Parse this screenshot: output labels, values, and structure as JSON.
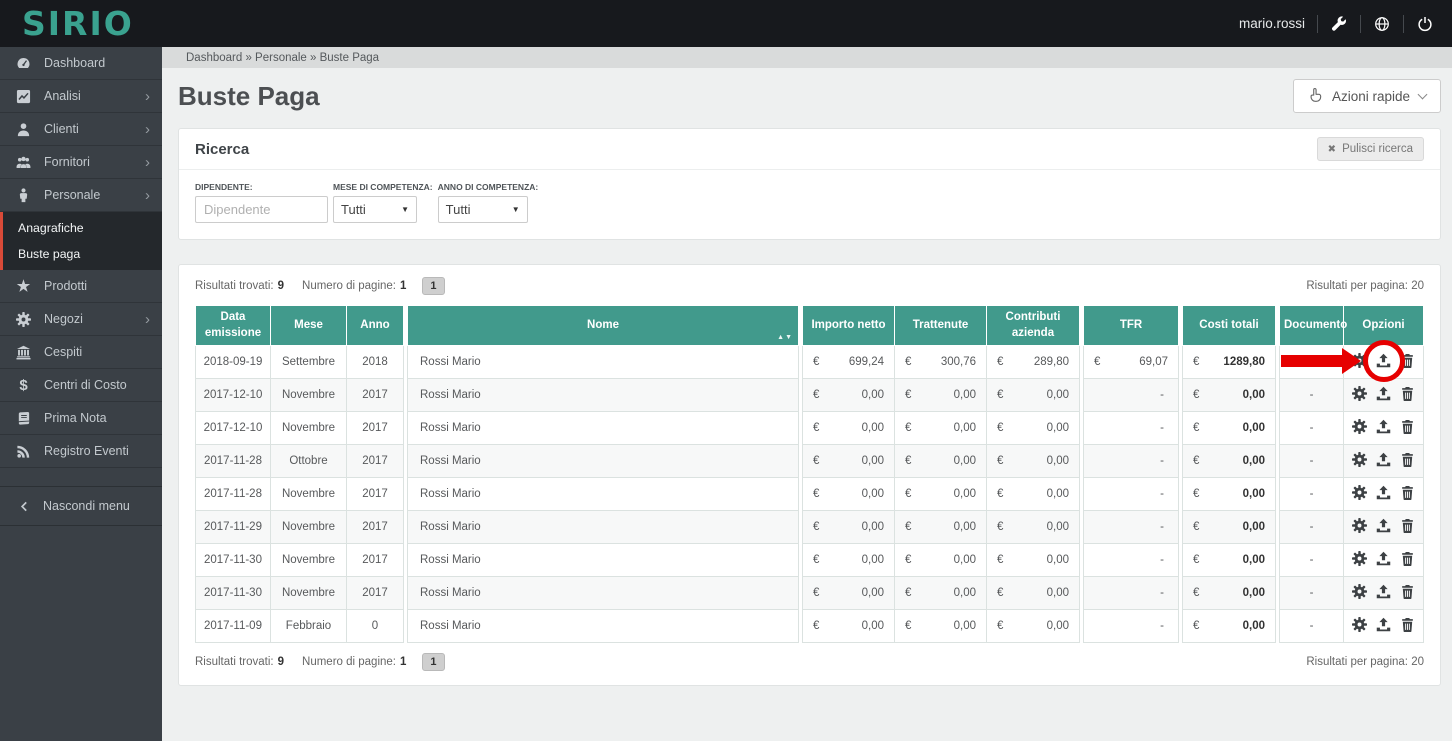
{
  "colors": {
    "accent_teal": "#419a8c",
    "logo_teal": "#3aa28f",
    "annotation_red": "#e60000",
    "sidebar_bg": "#3a4046",
    "topbar_bg": "#17191d",
    "submenu_red": "#d84a38"
  },
  "topbar": {
    "logo": "SIRIO",
    "username": "mario.rossi"
  },
  "sidebar": {
    "items": [
      {
        "label": "Dashboard",
        "icon": "dashboard",
        "chevron": false
      },
      {
        "label": "Analisi",
        "icon": "chart",
        "chevron": true
      },
      {
        "label": "Clienti",
        "icon": "user",
        "chevron": true
      },
      {
        "label": "Fornitori",
        "icon": "users",
        "chevron": true
      },
      {
        "label": "Personale",
        "icon": "person",
        "chevron": true,
        "submenu": [
          "Anagrafiche",
          "Buste paga"
        ]
      },
      {
        "label": "Prodotti",
        "icon": "star",
        "chevron": false
      },
      {
        "label": "Negozi",
        "icon": "gear",
        "chevron": true
      },
      {
        "label": "Cespiti",
        "icon": "bank",
        "chevron": false
      },
      {
        "label": "Centri di Costo",
        "icon": "dollar",
        "chevron": false
      },
      {
        "label": "Prima Nota",
        "icon": "book",
        "chevron": false
      },
      {
        "label": "Registro Eventi",
        "icon": "rss",
        "chevron": false
      }
    ],
    "collapse_label": "Nascondi menu"
  },
  "breadcrumb": {
    "text": "Dashboard » Personale » Buste Paga"
  },
  "page": {
    "title": "Buste Paga",
    "quick_actions": "Azioni rapide"
  },
  "search": {
    "title": "Ricerca",
    "clear_button": "Pulisci ricerca",
    "employee_label": "DIPENDENTE:",
    "employee_placeholder": "Dipendente",
    "month_label": "MESE DI COMPETENZA:",
    "month_value": "Tutti",
    "year_label": "ANNO DI COMPETENZA:",
    "year_value": "Tutti"
  },
  "results": {
    "found_label": "Risultati trovati:",
    "found_value": "9",
    "pages_label": "Numero di pagine:",
    "pages_value": "1",
    "page_button": "1",
    "per_page_label": "Risultati per pagina:",
    "per_page_value": "20"
  },
  "table": {
    "headers": [
      "Data emissione",
      "Mese",
      "Anno",
      "Nome",
      "Importo netto",
      "Trattenute",
      "Contributi azienda",
      "TFR",
      "Costi totali",
      "Documento",
      "Opzioni"
    ],
    "currency": "€",
    "rows": [
      {
        "date": "2018-09-19",
        "month": "Settembre",
        "year": "2018",
        "name": "Rossi Mario",
        "net": "699,24",
        "deductions": "300,76",
        "company_contrib": "289,80",
        "tfr": "69,07",
        "total": "1289,80",
        "document": "",
        "annotated": true
      },
      {
        "date": "2017-12-10",
        "month": "Novembre",
        "year": "2017",
        "name": "Rossi Mario",
        "net": "0,00",
        "deductions": "0,00",
        "company_contrib": "0,00",
        "tfr": "-",
        "total": "0,00",
        "document": "-",
        "annotated": false
      },
      {
        "date": "2017-12-10",
        "month": "Novembre",
        "year": "2017",
        "name": "Rossi Mario",
        "net": "0,00",
        "deductions": "0,00",
        "company_contrib": "0,00",
        "tfr": "-",
        "total": "0,00",
        "document": "-",
        "annotated": false
      },
      {
        "date": "2017-11-28",
        "month": "Ottobre",
        "year": "2017",
        "name": "Rossi Mario",
        "net": "0,00",
        "deductions": "0,00",
        "company_contrib": "0,00",
        "tfr": "-",
        "total": "0,00",
        "document": "-",
        "annotated": false
      },
      {
        "date": "2017-11-28",
        "month": "Novembre",
        "year": "2017",
        "name": "Rossi Mario",
        "net": "0,00",
        "deductions": "0,00",
        "company_contrib": "0,00",
        "tfr": "-",
        "total": "0,00",
        "document": "-",
        "annotated": false
      },
      {
        "date": "2017-11-29",
        "month": "Novembre",
        "year": "2017",
        "name": "Rossi Mario",
        "net": "0,00",
        "deductions": "0,00",
        "company_contrib": "0,00",
        "tfr": "-",
        "total": "0,00",
        "document": "-",
        "annotated": false
      },
      {
        "date": "2017-11-30",
        "month": "Novembre",
        "year": "2017",
        "name": "Rossi Mario",
        "net": "0,00",
        "deductions": "0,00",
        "company_contrib": "0,00",
        "tfr": "-",
        "total": "0,00",
        "document": "-",
        "annotated": false
      },
      {
        "date": "2017-11-30",
        "month": "Novembre",
        "year": "2017",
        "name": "Rossi Mario",
        "net": "0,00",
        "deductions": "0,00",
        "company_contrib": "0,00",
        "tfr": "-",
        "total": "0,00",
        "document": "-",
        "annotated": false
      },
      {
        "date": "2017-11-09",
        "month": "Febbraio",
        "year": "0",
        "name": "Rossi Mario",
        "net": "0,00",
        "deductions": "0,00",
        "company_contrib": "0,00",
        "tfr": "-",
        "total": "0,00",
        "document": "-",
        "annotated": false
      }
    ]
  }
}
